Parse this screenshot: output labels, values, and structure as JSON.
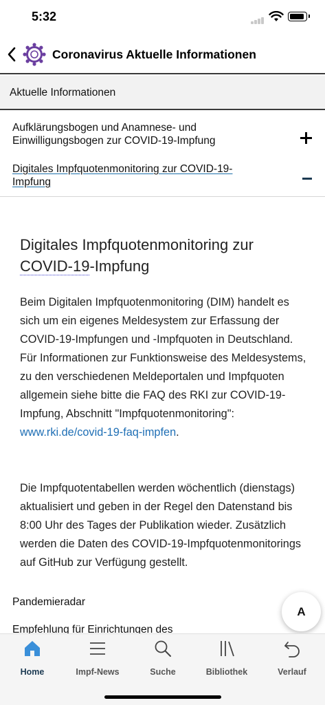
{
  "status_bar": {
    "time": "5:32"
  },
  "header": {
    "title": "Coronavirus Aktuelle Informationen"
  },
  "section": {
    "title": "Aktuelle Informationen"
  },
  "accordion": [
    {
      "label": "Aufklärungsbogen und Anamnese- und Einwilligungsbogen zur COVID-19-Impfung",
      "state": "collapsed"
    },
    {
      "label": "Digitales Impfquotenmonitoring zur COVID-19-Impfung",
      "state": "expanded"
    }
  ],
  "article": {
    "heading_part1": "Digitales Impfquotenmonitoring zur ",
    "heading_abbr": "COVID-19",
    "heading_part2": "-Impfung",
    "para1_text": "Beim Digitalen Impfquotenmonitoring (DIM) handelt es sich um ein eigenes Meldesystem zur Erfassung der COVID-19-Impfungen und -Impfquoten in Deutschland. Für Informationen zur Funktionsweise des Meldesystems, zu den verschiedenen Meldeportalen und Impfquoten allgemein siehe bitte die FAQ des RKI zur COVID-19-Impfung, Abschnitt \"Impfquotenmonitoring\": ",
    "para1_link": "www.rki.de/covid-19-faq-impfen",
    "para1_end": ".",
    "para2_text": "Die Impfquotentabellen werden wöchentlich (dienstags) aktualisiert und geben in der Regel den Datenstand bis 8:00 Uhr des Tages der Publikation wieder. Zusätzlich werden die Daten des COVID-19-Impfquotenmonitorings auf GitHub zur Verfügung gestellt."
  },
  "more_items": [
    {
      "label": "Pandemieradar"
    },
    {
      "label": "Empfehlung für Einrichtungen des"
    }
  ],
  "font_button": {
    "label": "A"
  },
  "tabs": [
    {
      "label": "Home",
      "icon": "home-icon",
      "active": true
    },
    {
      "label": "Impf-News",
      "icon": "menu-icon",
      "active": false
    },
    {
      "label": "Suche",
      "icon": "search-icon",
      "active": false
    },
    {
      "label": "Bibliothek",
      "icon": "library-icon",
      "active": false
    },
    {
      "label": "Verlauf",
      "icon": "history-icon",
      "active": false
    }
  ],
  "colors": {
    "accent": "#1c3a52",
    "link": "#1f6fb5",
    "logo_purple": "#6b3fa0",
    "divider": "#3a3a3a"
  }
}
